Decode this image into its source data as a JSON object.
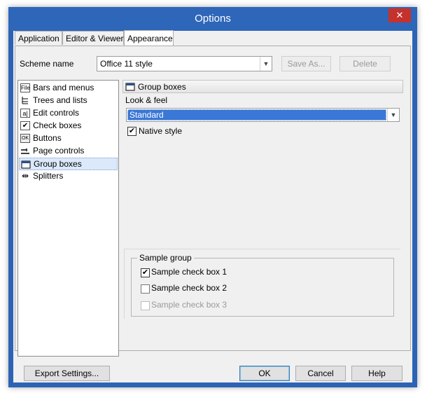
{
  "window": {
    "title": "Options",
    "close_glyph": "✕"
  },
  "tabs": [
    {
      "label": "Application"
    },
    {
      "label": "Editor & Viewers"
    },
    {
      "label": "Appearance"
    }
  ],
  "scheme": {
    "label": "Scheme name",
    "value": "Office 11 style",
    "save_as_label": "Save As...",
    "delete_label": "Delete"
  },
  "tree": {
    "items": [
      {
        "label": "Bars and menus",
        "icon": "toolbar-icon",
        "glyph": "File"
      },
      {
        "label": "Trees and lists",
        "icon": "tree-icon",
        "glyph": ""
      },
      {
        "label": "Edit controls",
        "icon": "edit-control-icon",
        "glyph": "a|"
      },
      {
        "label": "Check boxes",
        "icon": "checkbox-icon",
        "glyph": "✔"
      },
      {
        "label": "Buttons",
        "icon": "button-icon",
        "glyph": "OK"
      },
      {
        "label": "Page controls",
        "icon": "page-control-icon",
        "glyph": ""
      },
      {
        "label": "Group boxes",
        "icon": "group-box-icon",
        "glyph": ""
      },
      {
        "label": "Splitters",
        "icon": "splitter-icon",
        "glyph": "⇹"
      }
    ],
    "selected": "Group boxes"
  },
  "panel": {
    "header": "Group boxes",
    "look_feel_label": "Look & feel",
    "look_feel_value": "Standard",
    "native_style_label": "Native style",
    "native_style_checked": true
  },
  "sample_group": {
    "caption": "Sample group",
    "checks": [
      {
        "label": "Sample check box 1",
        "checked": true,
        "enabled": true
      },
      {
        "label": "Sample check box 2",
        "checked": false,
        "enabled": true
      },
      {
        "label": "Sample check box 3",
        "checked": false,
        "enabled": false
      }
    ]
  },
  "footer": {
    "export_label": "Export Settings...",
    "ok_label": "OK",
    "cancel_label": "Cancel",
    "help_label": "Help"
  },
  "colors": {
    "titlebar": "#2e66b9",
    "close": "#c7312b",
    "selection": "#3a77d6"
  }
}
